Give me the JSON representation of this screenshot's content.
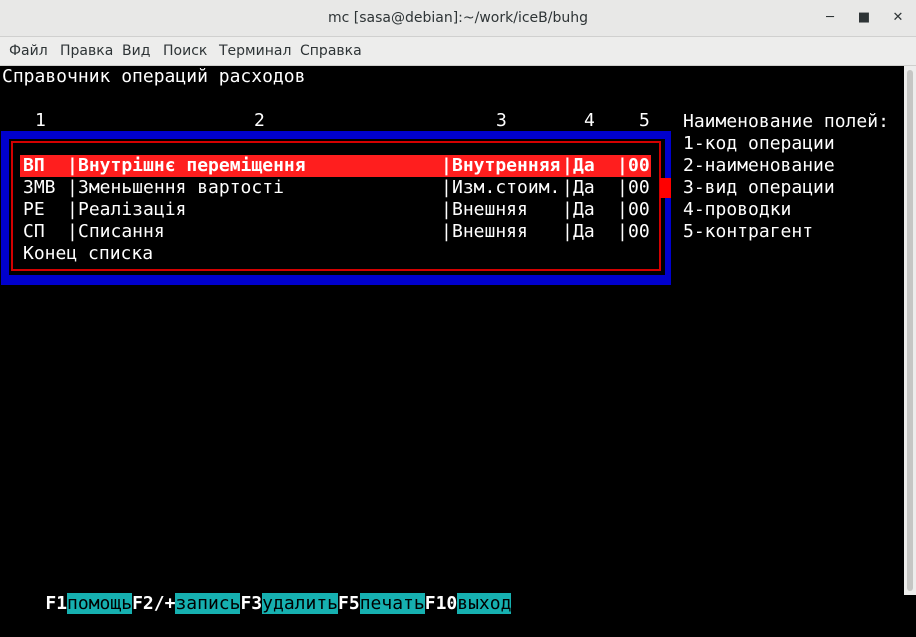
{
  "window": {
    "title": "mc [sasa@debian]:~/work/iceB/buhg",
    "minimize_icon": "minimize-icon",
    "maximize_icon": "maximize-icon",
    "close_icon": "close-icon"
  },
  "menu": [
    "Файл",
    "Правка",
    "Вид",
    "Поиск",
    "Терминал",
    "Справка"
  ],
  "screen": {
    "heading": "Справочник операций расходов",
    "column_numbers": [
      "1",
      "2",
      "3",
      "4",
      "5"
    ],
    "rows": [
      {
        "code": "ВП",
        "name": "Внутрішнє переміщення",
        "type": "Внутренняя",
        "post": "Да",
        "agent": "00",
        "selected": true
      },
      {
        "code": "ЗМВ",
        "name": "Зменьшення вартості",
        "type": "Изм.стоим.",
        "post": "Да",
        "agent": "00",
        "selected": false
      },
      {
        "code": "РЕ",
        "name": "Реалізація",
        "type": "Внешняя",
        "post": "Да",
        "agent": "00",
        "selected": false
      },
      {
        "code": "СП",
        "name": "Списання",
        "type": "Внешняя",
        "post": "Да",
        "agent": "00",
        "selected": false
      }
    ],
    "end_of_list": "Конец списка",
    "legend": {
      "title": "Наименование полей:",
      "items": [
        "1-код операции",
        "2-наименование",
        "3-вид операции",
        "4-проводки",
        "5-контрагент"
      ]
    }
  },
  "function_keys": [
    {
      "key": "F1",
      "label": "помощь"
    },
    {
      "key": "F2/+",
      "label": "запись"
    },
    {
      "key": "F3",
      "label": "удалить"
    },
    {
      "key": "F5",
      "label": "печать"
    },
    {
      "key": "F10",
      "label": "выход"
    }
  ],
  "colors": {
    "terminal_bg": "#000000",
    "box_blue": "#0000cd",
    "frame_red": "#d40000",
    "selection_red": "#ff1e1e",
    "fkey_label_bg": "#16b0b0"
  }
}
